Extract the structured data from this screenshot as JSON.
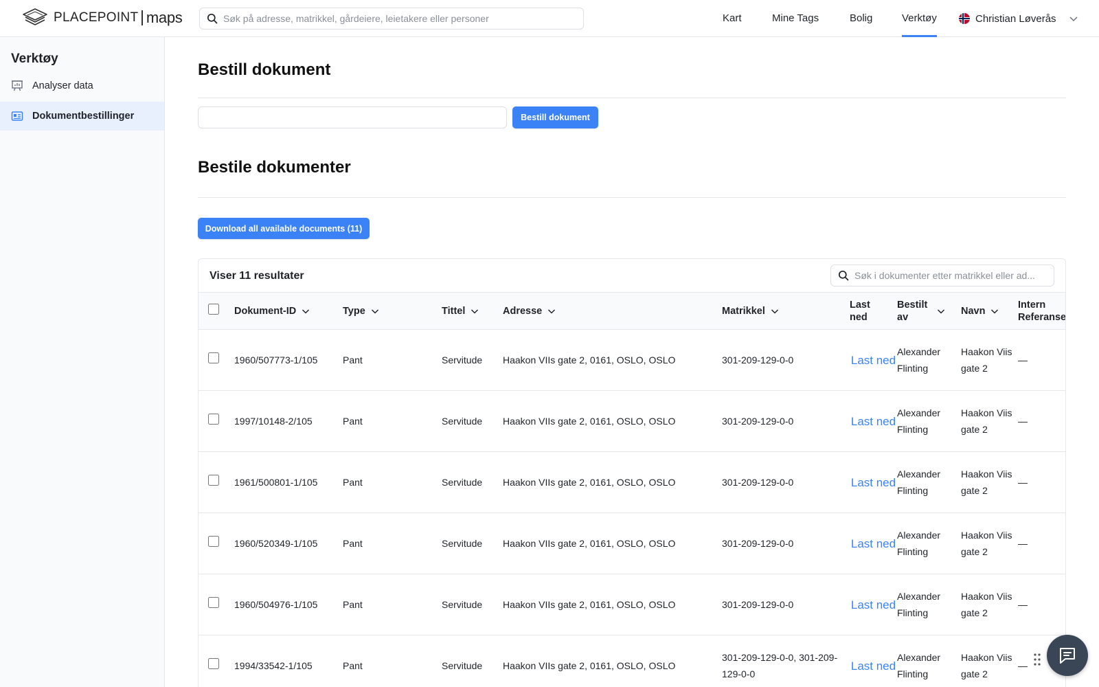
{
  "header": {
    "logo_text": "PLACEPOINT",
    "logo_sub": "maps",
    "search_placeholder": "Søk på adresse, matrikkel, gårdeiere, leietakere eller personer",
    "nav": [
      "Kart",
      "Mine Tags",
      "Bolig",
      "Verktøy"
    ],
    "active_nav": "Verktøy",
    "user_name": "Christian Løverås"
  },
  "sidebar": {
    "title": "Verktøy",
    "items": [
      {
        "label": "Analyser data",
        "icon": "presentation-chart-icon"
      },
      {
        "label": "Dokumentbestillinger",
        "icon": "id-card-icon"
      }
    ],
    "active_item": "Dokumentbestillinger"
  },
  "order": {
    "title": "Bestill dokument",
    "input_value": "",
    "button_label": "Bestill dokument"
  },
  "documents": {
    "title": "Bestile dokumenter",
    "download_all_label": "Download all available documents (11)",
    "results_label": "Viser 11 resultater",
    "search_placeholder": "Søk i dokumenter etter matrikkel eller ad...",
    "columns": [
      "Dokument-ID",
      "Type",
      "Tittel",
      "Adresse",
      "Matrikkel",
      "Last ned",
      "Bestilt av",
      "Navn",
      "Intern Referanse"
    ],
    "rows": [
      {
        "id": "1960/507773-1/105",
        "type": "Pant",
        "title": "Servitude",
        "address": "Haakon VIIs gate 2, 0161, OSLO, OSLO",
        "matrikkel": "301-209-129-0-0",
        "download": "Last ned",
        "ordered_by": "Alexander Flinting",
        "name": "Haakon Viis gate 2",
        "ref": "—"
      },
      {
        "id": "1997/10148-2/105",
        "type": "Pant",
        "title": "Servitude",
        "address": "Haakon VIIs gate 2, 0161, OSLO, OSLO",
        "matrikkel": "301-209-129-0-0",
        "download": "Last ned",
        "ordered_by": "Alexander Flinting",
        "name": "Haakon Viis gate 2",
        "ref": "—"
      },
      {
        "id": "1961/500801-1/105",
        "type": "Pant",
        "title": "Servitude",
        "address": "Haakon VIIs gate 2, 0161, OSLO, OSLO",
        "matrikkel": "301-209-129-0-0",
        "download": "Last ned",
        "ordered_by": "Alexander Flinting",
        "name": "Haakon Viis gate 2",
        "ref": "—"
      },
      {
        "id": "1960/520349-1/105",
        "type": "Pant",
        "title": "Servitude",
        "address": "Haakon VIIs gate 2, 0161, OSLO, OSLO",
        "matrikkel": "301-209-129-0-0",
        "download": "Last ned",
        "ordered_by": "Alexander Flinting",
        "name": "Haakon Viis gate 2",
        "ref": "—"
      },
      {
        "id": "1960/504976-1/105",
        "type": "Pant",
        "title": "Servitude",
        "address": "Haakon VIIs gate 2, 0161, OSLO, OSLO",
        "matrikkel": "301-209-129-0-0",
        "download": "Last ned",
        "ordered_by": "Alexander Flinting",
        "name": "Haakon Viis gate 2",
        "ref": "—"
      },
      {
        "id": "1994/33542-1/105",
        "type": "Pant",
        "title": "Servitude",
        "address": "Haakon VIIs gate 2, 0161, OSLO, OSLO",
        "matrikkel": "301-209-129-0-0, 301-209-129-0-0",
        "download": "Last ned",
        "ordered_by": "Alexander Flinting",
        "name": "Haakon Viis gate 2",
        "ref": "—"
      }
    ]
  },
  "colors": {
    "accent": "#3b82f6",
    "fab": "#3a4656"
  }
}
